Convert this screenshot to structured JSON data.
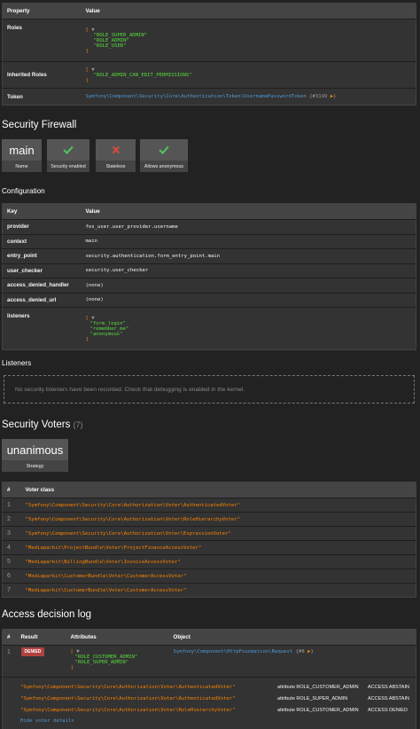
{
  "token_table": {
    "headers": [
      "Property",
      "Value"
    ],
    "roles_label": "Roles",
    "roles": [
      "\"ROLE_SUPER_ADMIN\"",
      "\"ROLE_ADMIN\"",
      "\"ROLE_USER\""
    ],
    "inherited_label": "Inherited Roles",
    "inherited": [
      "\"ROLE_ADMIN_CAN_EDIT_PERMISSIONS\""
    ],
    "token_label": "Token",
    "token_class": "Symfony\\Component\\Security\\Core\\Authentication\\Token\\UsernamePasswordToken",
    "token_ref": "{#3199",
    "token_ref_end": "}",
    "array_open": "[",
    "array_close": "]",
    "caret": "▼",
    "expand_arrow": "▶"
  },
  "firewall": {
    "title": "Security Firewall",
    "name_value": "main",
    "name_label": "Name",
    "security_label": "Security enabled",
    "stateless_label": "Stateless",
    "anonymous_label": "Allows anonymous",
    "colors": {
      "yes": "#4ec45a",
      "no": "#d04b45"
    }
  },
  "configuration": {
    "title": "Configuration",
    "headers": [
      "Key",
      "Value"
    ],
    "rows": [
      {
        "key": "provider",
        "value": "fos_user.user_provider.username"
      },
      {
        "key": "context",
        "value": "main"
      },
      {
        "key": "entry_point",
        "value": "security.authentication.form_entry_point.main"
      },
      {
        "key": "user_checker",
        "value": "security.user_checker"
      },
      {
        "key": "access_denied_handler",
        "value": "(none)"
      },
      {
        "key": "access_denied_url",
        "value": "(none)"
      }
    ],
    "listeners_key": "listeners",
    "listeners": [
      "\"form_login\"",
      "\"remember_me\"",
      "\"anonymous\""
    ]
  },
  "listeners_section": {
    "title": "Listeners",
    "empty_message": "No security listeners have been recorded. Check that debugging is enabled in the kernel."
  },
  "voters": {
    "title": "Security Voters",
    "count": "(7)",
    "strategy_value": "unanimous",
    "strategy_label": "Strategy",
    "headers": [
      "#",
      "Voter class"
    ],
    "rows": [
      {
        "n": "1",
        "cls": "\"Symfony\\Component\\Security\\Core\\Authorization\\Voter\\AuthenticatedVoter\""
      },
      {
        "n": "2",
        "cls": "\"Symfony\\Component\\Security\\Core\\Authorization\\Voter\\RoleHierarchyVoter\""
      },
      {
        "n": "3",
        "cls": "\"Symfony\\Component\\Security\\Core\\Authorization\\Voter\\ExpressionVoter\""
      },
      {
        "n": "4",
        "cls": "\"Mediaparkit\\ProjectBundle\\Voter\\ProjectFinanceAccessVoter\""
      },
      {
        "n": "5",
        "cls": "\"Mediaparkit\\BillingBundle\\Voter\\InvoiceAccessVoter\""
      },
      {
        "n": "6",
        "cls": "\"Mediaparkit\\CustomerBundle\\Voter\\CustomerAccessVoter\""
      },
      {
        "n": "7",
        "cls": "\"Mediaparkit\\CustomerBundle\\Voter\\CustomerAccessVoter\""
      }
    ]
  },
  "log": {
    "title": "Access decision log",
    "headers": [
      "#",
      "Result",
      "Attributes",
      "Object"
    ],
    "entry_n": "1",
    "result": "DENIED",
    "attributes": [
      "\"ROLE_CUSTOMER_ADMIN\"",
      "\"ROLE_SUPER_ADMIN\""
    ],
    "array_open": "[",
    "array_close": "]",
    "object_class": "Symfony\\Component\\HttpFoundation\\Request",
    "object_ref": "{#8",
    "object_ref_end": "}",
    "details": [
      {
        "voter": "\"Symfony\\Component\\Security\\Core\\Authorization\\Voter\\AuthenticatedVoter\"",
        "attr": "attribute ROLE_CUSTOMER_ADMIN",
        "vote": "ACCESS ABSTAIN"
      },
      {
        "voter": "\"Symfony\\Component\\Security\\Core\\Authorization\\Voter\\AuthenticatedVoter\"",
        "attr": "attribute ROLE_SUPER_ADMIN",
        "vote": "ACCESS ABSTAIN"
      },
      {
        "voter": "\"Symfony\\Component\\Security\\Core\\Authorization\\Voter\\RoleHierarchyVoter\"",
        "attr": "attribute ROLE_CUSTOMER_ADMIN",
        "vote": "ACCESS DENIED"
      }
    ],
    "hide_link": "Hide voter details"
  }
}
